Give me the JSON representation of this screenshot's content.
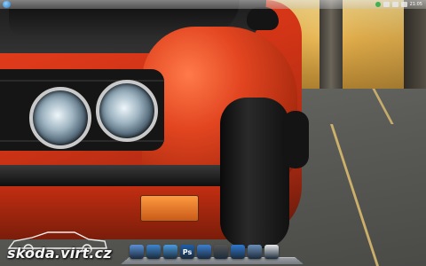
{
  "menubar": {
    "clock": "21:05"
  },
  "watermark": {
    "text": "skoda.virt.cz"
  },
  "dock": {
    "items": [
      {
        "name": "finder",
        "label": "",
        "color": "#5b8fd6"
      },
      {
        "name": "safari",
        "label": "",
        "color": "#3e87cf"
      },
      {
        "name": "messages",
        "label": "",
        "color": "#4a9be0"
      },
      {
        "name": "photoshop",
        "label": "Ps",
        "color": "#1e5ea8"
      },
      {
        "name": "itunes",
        "label": "",
        "color": "#3d7fd0"
      },
      {
        "name": "calculator",
        "label": "",
        "color": "#555555"
      },
      {
        "name": "app-store",
        "label": "",
        "color": "#2f78d0"
      },
      {
        "name": "preview",
        "label": "",
        "color": "#6c8fb8"
      },
      {
        "name": "textedit",
        "label": "",
        "color": "#e9e9e9"
      }
    ]
  }
}
